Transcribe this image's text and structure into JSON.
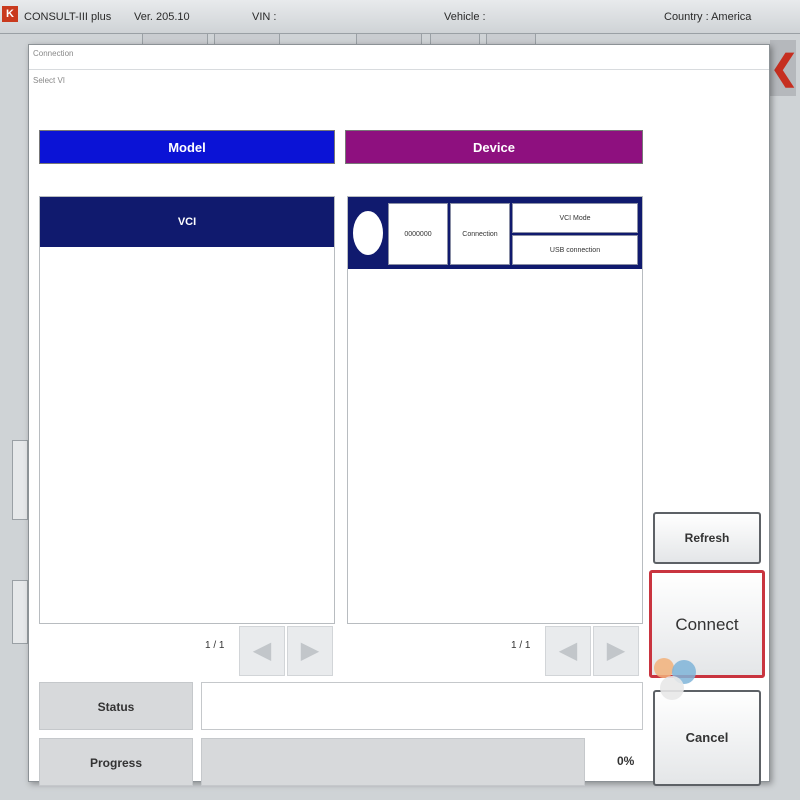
{
  "app": {
    "logo": "K",
    "title": "CONSULT-III plus",
    "version": "Ver. 205.10",
    "item_vin": "VIN :",
    "item_vehicle": "Vehicle :",
    "item_country": "Country : America"
  },
  "dialog": {
    "title": "Connection",
    "subtitle": "Select VI"
  },
  "model": {
    "header": "Model",
    "item": "VCI",
    "pager": "1 / 1"
  },
  "device": {
    "header": "Device",
    "cell_serial": "0000000",
    "cell_status": "Connection",
    "cell_mode": "VCI Mode",
    "cell_link": "USB connection",
    "pager": "1 / 1"
  },
  "status": {
    "label": "Status",
    "value": ""
  },
  "progress": {
    "label": "Progress",
    "value": 0,
    "text": "0%"
  },
  "buttons": {
    "refresh": "Refresh",
    "connect": "Connect",
    "cancel": "Cancel"
  },
  "colors": {
    "model_header": "#0b13d6",
    "device_header": "#8e107f",
    "selected_row": "#101a6e",
    "connect_border": "#c9343f"
  },
  "icons": {
    "prev": "triangle-left",
    "next": "triangle-right",
    "close": "close-x"
  }
}
